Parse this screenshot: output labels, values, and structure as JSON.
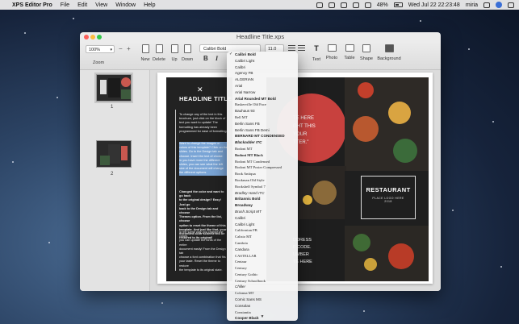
{
  "menubar": {
    "apple_glyph": "",
    "app_name": "XPS Editor Pro",
    "menus": [
      "File",
      "Edit",
      "View",
      "Window",
      "Help"
    ],
    "battery": "48%",
    "clock": "Wed Jul 22  22:23:48",
    "user": "miria"
  },
  "window": {
    "title": "Headline Title.xps"
  },
  "toolbar": {
    "zoom_value": "100%",
    "zoom_label": "Zoom",
    "zoom_minus": "−",
    "zoom_plus": "+",
    "buttons": {
      "new": "New",
      "delete": "Delete",
      "up": "Up",
      "down": "Down",
      "text": "Text",
      "photo": "Photo",
      "table": "Table",
      "shape": "Shape",
      "background": "Background"
    },
    "font_value": "Calibri Bold",
    "size_value": "11.0",
    "bold": "B",
    "italic": "I"
  },
  "sidebar": {
    "pages": [
      "1",
      "2"
    ]
  },
  "document": {
    "utensil_glyph": "✕",
    "headline": "HEADLINE TITLE",
    "para1": "To change any of the text in this\nbrochure, just click on the block of\ntext you want to update! The\nformatting has already been\nprogrammed for ease of formatting.",
    "para2": "Want to change the images or\ncolors of this template? Click on the\nslides. Go to the Design tab and\nchoose. Insert the text of choice\nIn you have more the different\nslides, you can see what the left\nsize of the document will change\nthe different options.",
    "para3": "Changed the color and want to go back\nto the original design? Easy! Just go\nback to the Design tab and choose\nThemes option. From the list, choose\noption to reset the theme of this\ntemplate. And just like that, your\ndocument color scheme will be\nrestored to its original!",
    "para4": "In the same way you change the colors,\nyou can update the fonts of the entire\ndocument easily! From the Design tab\nchoose a font combination that fits\nyour taste. Reset the theme to restore\nthe template to its original state.",
    "red_text": "TE HERE\nGHT THIS\nYOUR\nTTER.”",
    "address_text": "DDRESS\nP CODE.\nUMBER\nTE HERE",
    "restaurant_title": "RESTAURANT",
    "restaurant_sub": "PLACE LOGO HERE\n2018"
  },
  "font_menu": {
    "selected": "Calibri Bold",
    "items": [
      "Calibri Bold",
      "Calibri Light",
      "Calibri",
      "Agency FB",
      "ALGERIAN",
      "Arial",
      "Arial Narrow",
      "Arial Rounded MT Bold",
      "Baskerville Old Face",
      "Bauhaus 93",
      "Bell MT",
      "Berlin Sans FB",
      "Berlin Sans FB Demi",
      "BERNARD MT CONDENSED",
      "Blackadder ITC",
      "Bodoni MT",
      "Bodoni MT Black",
      "Bodoni MT Condensed",
      "Bodoni MT Poster Compressed",
      "Book Antiqua",
      "Bookman Old Style",
      "Bookshelf Symbol 7",
      "Bradley Hand ITC",
      "Britannic Bold",
      "Broadway",
      "Brush Script MT",
      "Calibri",
      "Calibri Light",
      "Californian FB",
      "Calisto MT",
      "Cambria",
      "Candara",
      "CASTELLAR",
      "Centaur",
      "Century",
      "Century Gothic",
      "Century Schoolbook",
      "Chiller",
      "Colonna MT",
      "Comic Sans MS",
      "Consolas",
      "Constantia",
      "Cooper Black",
      "COPPERPLATE GOTHIC BOLD",
      "COPPERPLATE GOTHIC LIGHT"
    ],
    "more_arrow": "▼"
  },
  "colors": {
    "accent_red": "#c8413e",
    "selection_blue": "#7aa5d6"
  }
}
